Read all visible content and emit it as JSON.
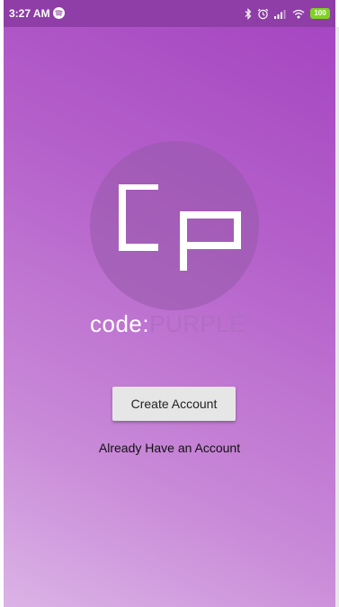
{
  "status_bar": {
    "time": "3:27 AM",
    "battery_level": "100",
    "icons": [
      "spotify-icon",
      "bluetooth-icon",
      "alarm-icon",
      "signal-icon",
      "wifi-icon",
      "battery-icon"
    ]
  },
  "logo": {
    "mark": "Cp",
    "code_text": "code:",
    "purple_text": "PURPLE"
  },
  "actions": {
    "create_account_label": "Create Account",
    "login_label": "Already Have an Account"
  },
  "colors": {
    "status_bar": "#8e3ea6",
    "gradient_top": "#a444c0",
    "gradient_bottom": "#dbb3e6",
    "button_bg": "#e6e6e6",
    "battery": "#7ed321"
  }
}
